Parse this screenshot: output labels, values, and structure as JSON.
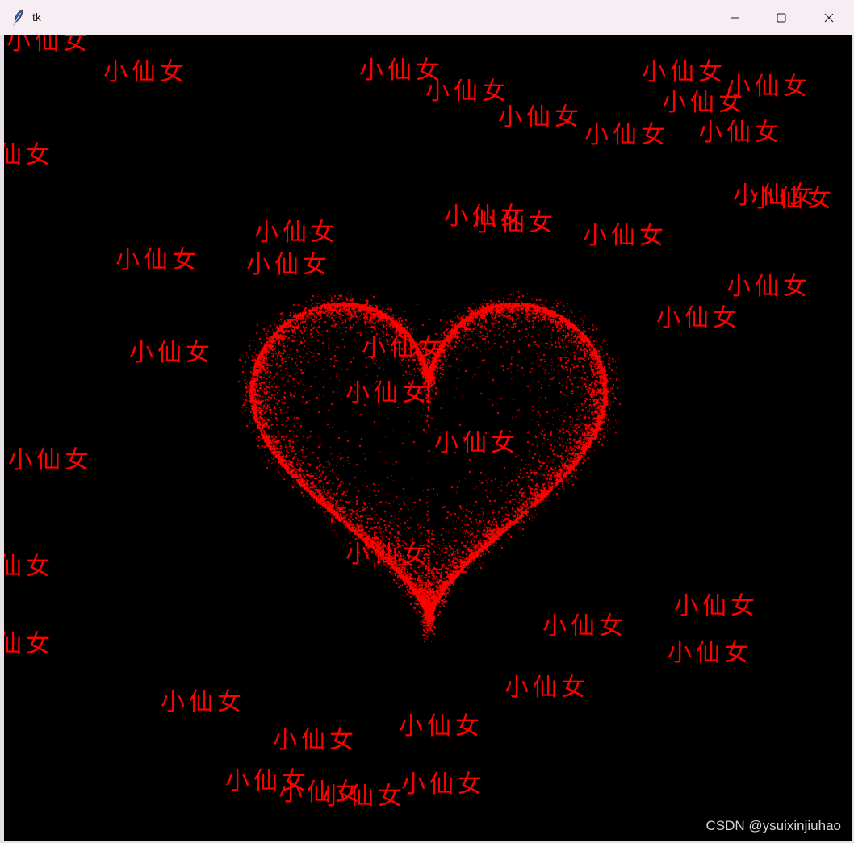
{
  "window": {
    "title": "tk",
    "icon": "feather-icon",
    "controls": {
      "minimize": "minimize-icon",
      "maximize": "maximize-icon",
      "close": "close-icon"
    },
    "titlebar_color": "#f7eef4"
  },
  "canvas": {
    "background": "#000000",
    "floating_text": "小仙女",
    "text_color": "#ff0000",
    "heart": {
      "particle_color": "#ff0000"
    }
  },
  "watermark": {
    "text": "CSDN @ysuixinjiuhao"
  }
}
